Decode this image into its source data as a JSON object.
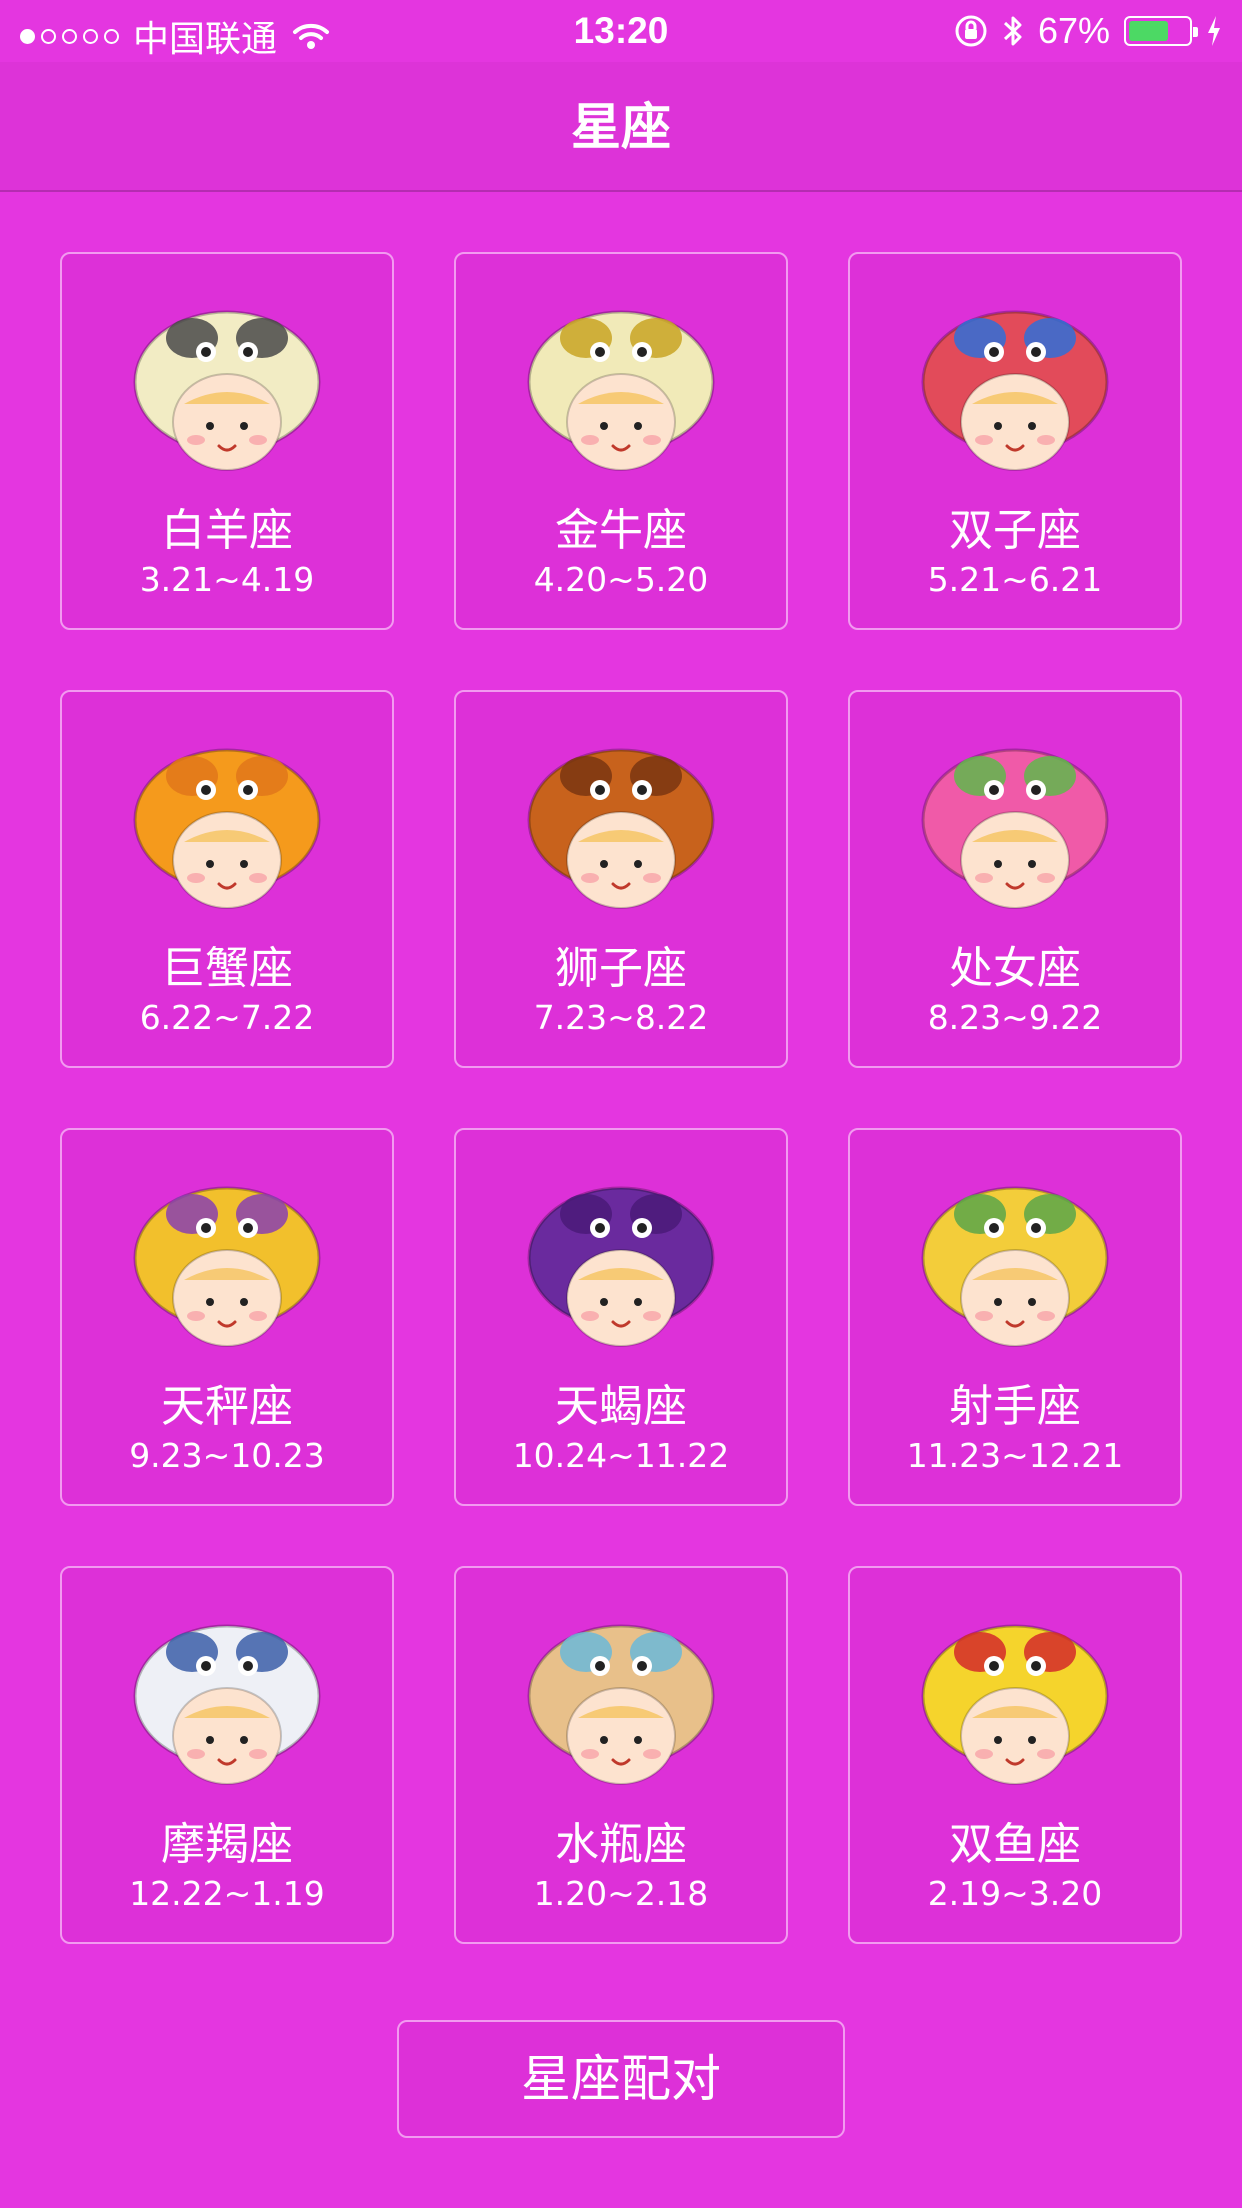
{
  "status_bar": {
    "carrier": "中国联通",
    "time": "13:20",
    "battery_percent": "67%",
    "battery_level": 0.67,
    "signal_bars_filled": 1,
    "signal_bars_total": 5
  },
  "nav": {
    "title": "星座"
  },
  "signs": [
    {
      "name": "白羊座",
      "dates": "3.21~4.19",
      "icon": "aries-ram-avatar-icon",
      "color": "#f2ecc4",
      "accent": "#4a4a4a"
    },
    {
      "name": "金牛座",
      "dates": "4.20~5.20",
      "icon": "taurus-bull-avatar-icon",
      "color": "#f1eab8",
      "accent": "#c9a423"
    },
    {
      "name": "双子座",
      "dates": "5.21~6.21",
      "icon": "gemini-hat-avatar-icon",
      "color": "#e24b5a",
      "accent": "#2f6fd8"
    },
    {
      "name": "巨蟹座",
      "dates": "6.22~7.22",
      "icon": "cancer-crab-avatar-icon",
      "color": "#f59a1c",
      "accent": "#e0771a"
    },
    {
      "name": "狮子座",
      "dates": "7.23~8.22",
      "icon": "leo-lion-avatar-icon",
      "color": "#c8621c",
      "accent": "#7a3610"
    },
    {
      "name": "处女座",
      "dates": "8.23~9.22",
      "icon": "virgo-maiden-avatar-icon",
      "color": "#f05aa8",
      "accent": "#5fb84b"
    },
    {
      "name": "天秤座",
      "dates": "9.23~10.23",
      "icon": "libra-scales-avatar-icon",
      "color": "#f2c02c",
      "accent": "#8a3fb0"
    },
    {
      "name": "天蝎座",
      "dates": "10.24~11.22",
      "icon": "scorpio-scorpion-avatar-icon",
      "color": "#6a2a9e",
      "accent": "#4a1a78"
    },
    {
      "name": "射手座",
      "dates": "11.23~12.21",
      "icon": "sagittarius-helmet-avatar-icon",
      "color": "#f3cd3a",
      "accent": "#5aa64a"
    },
    {
      "name": "摩羯座",
      "dates": "12.22~1.19",
      "icon": "capricorn-goat-avatar-icon",
      "color": "#eef0f6",
      "accent": "#3b5ea8"
    },
    {
      "name": "水瓶座",
      "dates": "1.20~2.18",
      "icon": "aquarius-jar-avatar-icon",
      "color": "#e8c08a",
      "accent": "#6bb8d8"
    },
    {
      "name": "双鱼座",
      "dates": "2.19~3.20",
      "icon": "pisces-fish-avatar-icon",
      "color": "#f5d42c",
      "accent": "#d42a2a"
    }
  ],
  "match_button": {
    "label": "星座配对"
  }
}
